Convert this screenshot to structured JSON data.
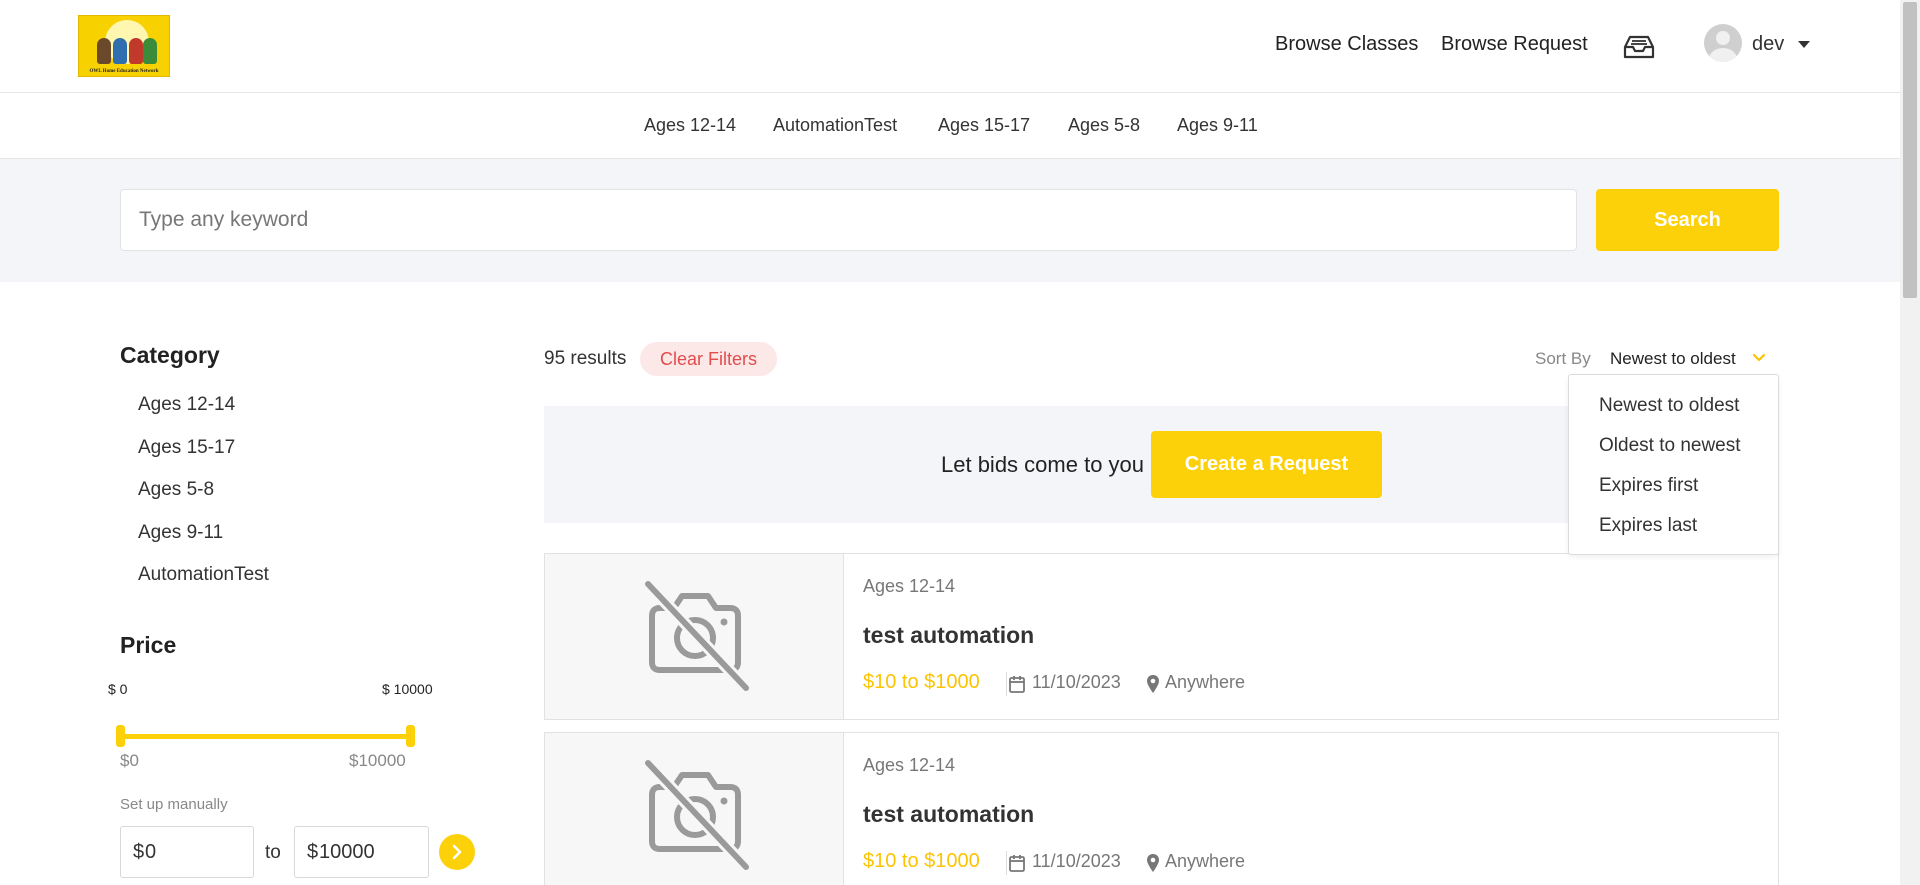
{
  "brand": {
    "logo_text": "OWL Home Education Network"
  },
  "nav": {
    "browse_classes": "Browse Classes",
    "browse_request": "Browse Request",
    "inbox_icon": "inbox-tray-icon",
    "username": "dev"
  },
  "category_bar": [
    "Ages 12-14",
    "AutomationTest",
    "Ages 15-17",
    "Ages 5-8",
    "Ages 9-11"
  ],
  "search": {
    "placeholder": "Type any keyword",
    "value": "",
    "button_label": "Search"
  },
  "sidebar": {
    "category_heading": "Category",
    "categories": [
      "Ages 12-14",
      "Ages 15-17",
      "Ages 5-8",
      "Ages 9-11",
      "AutomationTest"
    ],
    "price_heading": "Price",
    "slider_top_min": "$ 0",
    "slider_top_max": "$ 10000",
    "slider_min_label": "$0",
    "slider_max_label": "$10000",
    "slider_range": [
      0,
      10000
    ],
    "setup_manually": "Set up manually",
    "currency_symbol": "$",
    "min_value": "0",
    "max_value": "10000",
    "to_label": "to"
  },
  "results": {
    "count_text": "95 results",
    "clear_filters": "Clear Filters",
    "sort_by_label": "Sort By",
    "sort_by_value": "Newest to oldest",
    "sort_options": [
      "Newest to oldest",
      "Oldest to newest",
      "Expires first",
      "Expires last"
    ]
  },
  "cta": {
    "text": "Let bids come to you",
    "button_label": "Create a Request"
  },
  "cards": [
    {
      "category": "Ages 12-14",
      "title": "test automation",
      "price": "$10 to $1000",
      "date": "11/10/2023",
      "location": "Anywhere",
      "image_icon": "no-camera-icon"
    },
    {
      "category": "Ages 12-14",
      "title": "test automation",
      "price": "$10 to $1000",
      "date": "11/10/2023",
      "location": "Anywhere",
      "image_icon": "no-camera-icon"
    }
  ],
  "colors": {
    "accent": "#fcd10a",
    "clear_filters_bg": "#fde8e8",
    "clear_filters_text": "#e24c4c",
    "band_bg": "#f4f5f8"
  }
}
